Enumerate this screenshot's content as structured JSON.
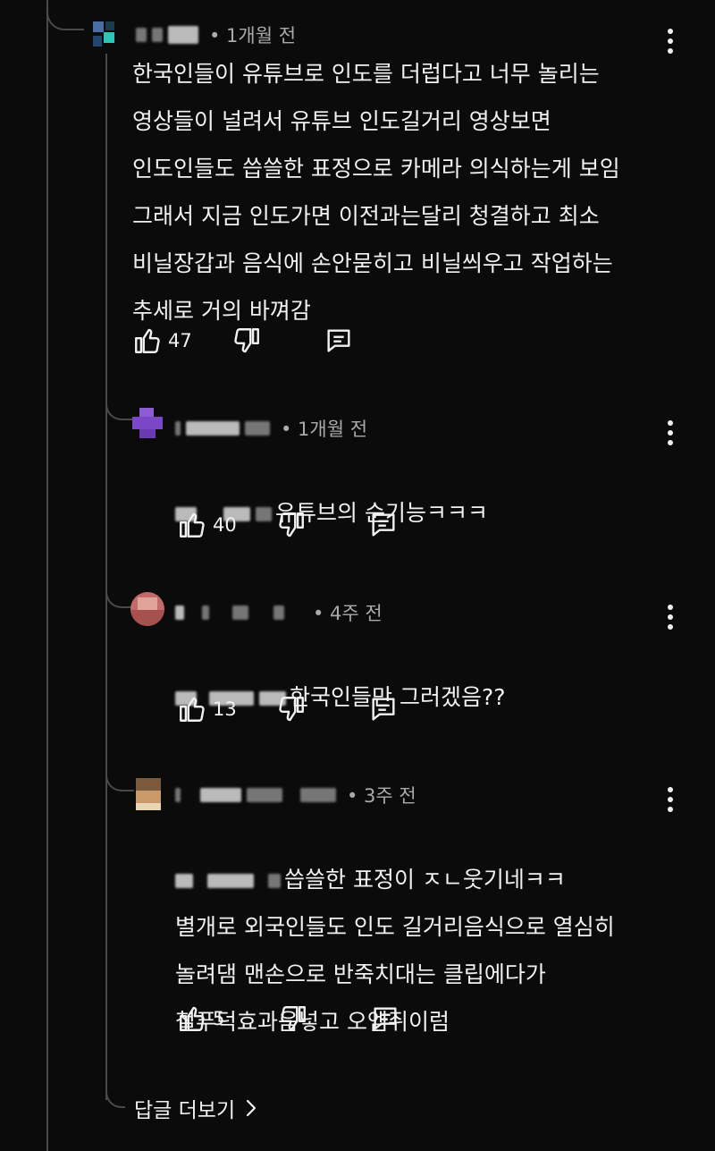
{
  "comments": [
    {
      "time": "• 1개월 전",
      "text": "한국인들이 유튜브로 인도를  더럽다고 너무 놀리는\n영상들이 널려서 유튜브 인도길거리 영상보면\n인도인들도 씁쓸한 표정으로 카메라 의식하는게 보임\n그래서 지금 인도가면 이전과는달리 청결하고 최소\n비닐장갑과 음식에 손안묻히고 비닐씌우고 작업하는\n추세로 거의 바껴감",
      "likes": "47"
    }
  ],
  "replies": [
    {
      "time": "• 1개월 전",
      "text": "유튜브의 순기능ㅋㅋㅋ",
      "likes": "40"
    },
    {
      "time": "• 4주 전",
      "text": "한국인들만 그러겠음??",
      "likes": "13"
    },
    {
      "time": "• 3주 전",
      "first_line": "씁쓸한 표정이 ㅈㄴ웃기네ㅋㅋ",
      "rest": "별개로 외국인들도 인도 길거리음식으로 열심히\n놀려댐 맨손으로 반죽치대는 클립에다가\n철푸덕효과음넣고 오엠쥐이럼",
      "likes": "5"
    }
  ],
  "more_replies_label": "답글 더보기"
}
